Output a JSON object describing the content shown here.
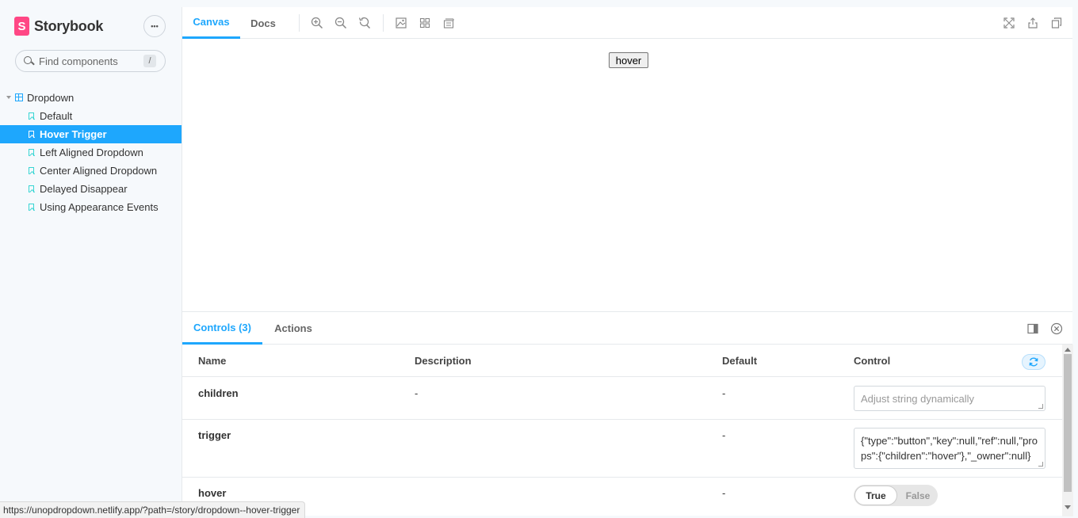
{
  "brand": {
    "logo_letter": "S",
    "name": "Storybook",
    "menu_label": "•••"
  },
  "search": {
    "placeholder": "Find components",
    "shortcut": "/"
  },
  "tree": {
    "group": "Dropdown",
    "items": [
      {
        "label": "Default"
      },
      {
        "label": "Hover Trigger",
        "active": true
      },
      {
        "label": "Left Aligned Dropdown"
      },
      {
        "label": "Center Aligned Dropdown"
      },
      {
        "label": "Delayed Disappear"
      },
      {
        "label": "Using Appearance Events"
      }
    ]
  },
  "toolbar": {
    "tabs": [
      {
        "label": "Canvas",
        "active": true
      },
      {
        "label": "Docs"
      }
    ],
    "icons": [
      "zoom-in-icon",
      "zoom-out-icon",
      "zoom-reset-icon",
      "background-icon",
      "grid-icon",
      "outline-icon",
      "fullscreen-icon",
      "share-icon",
      "copy-link-icon"
    ]
  },
  "canvas": {
    "preview_button": "hover"
  },
  "addons": {
    "tabs": [
      {
        "label": "Controls (3)",
        "active": true
      },
      {
        "label": "Actions"
      }
    ],
    "icons": [
      "panel-orientation-icon",
      "close-panel-icon"
    ]
  },
  "controls": {
    "headers": {
      "name": "Name",
      "description": "Description",
      "default": "Default",
      "control": "Control"
    },
    "rows": [
      {
        "name": "children",
        "description": "-",
        "default": "-",
        "control_placeholder": "Adjust string dynamically"
      },
      {
        "name": "trigger",
        "description": "",
        "default": "-",
        "control_value": "{\"type\":\"button\",\"key\":null,\"ref\":null,\"props\":{\"children\":\"hover\"},\"_owner\":null}"
      },
      {
        "name": "hover",
        "description": "",
        "default": "-",
        "toggle_true": "True",
        "toggle_false": "False",
        "toggle_value": true
      }
    ]
  },
  "status_url": "https://unopdropdown.netlify.app/?path=/story/dropdown--hover-trigger",
  "colors": {
    "accent": "#1ea7fd",
    "brand": "#ff4785",
    "story_icon": "#37d5d3",
    "sidebar_bg": "#f6f9fc"
  }
}
